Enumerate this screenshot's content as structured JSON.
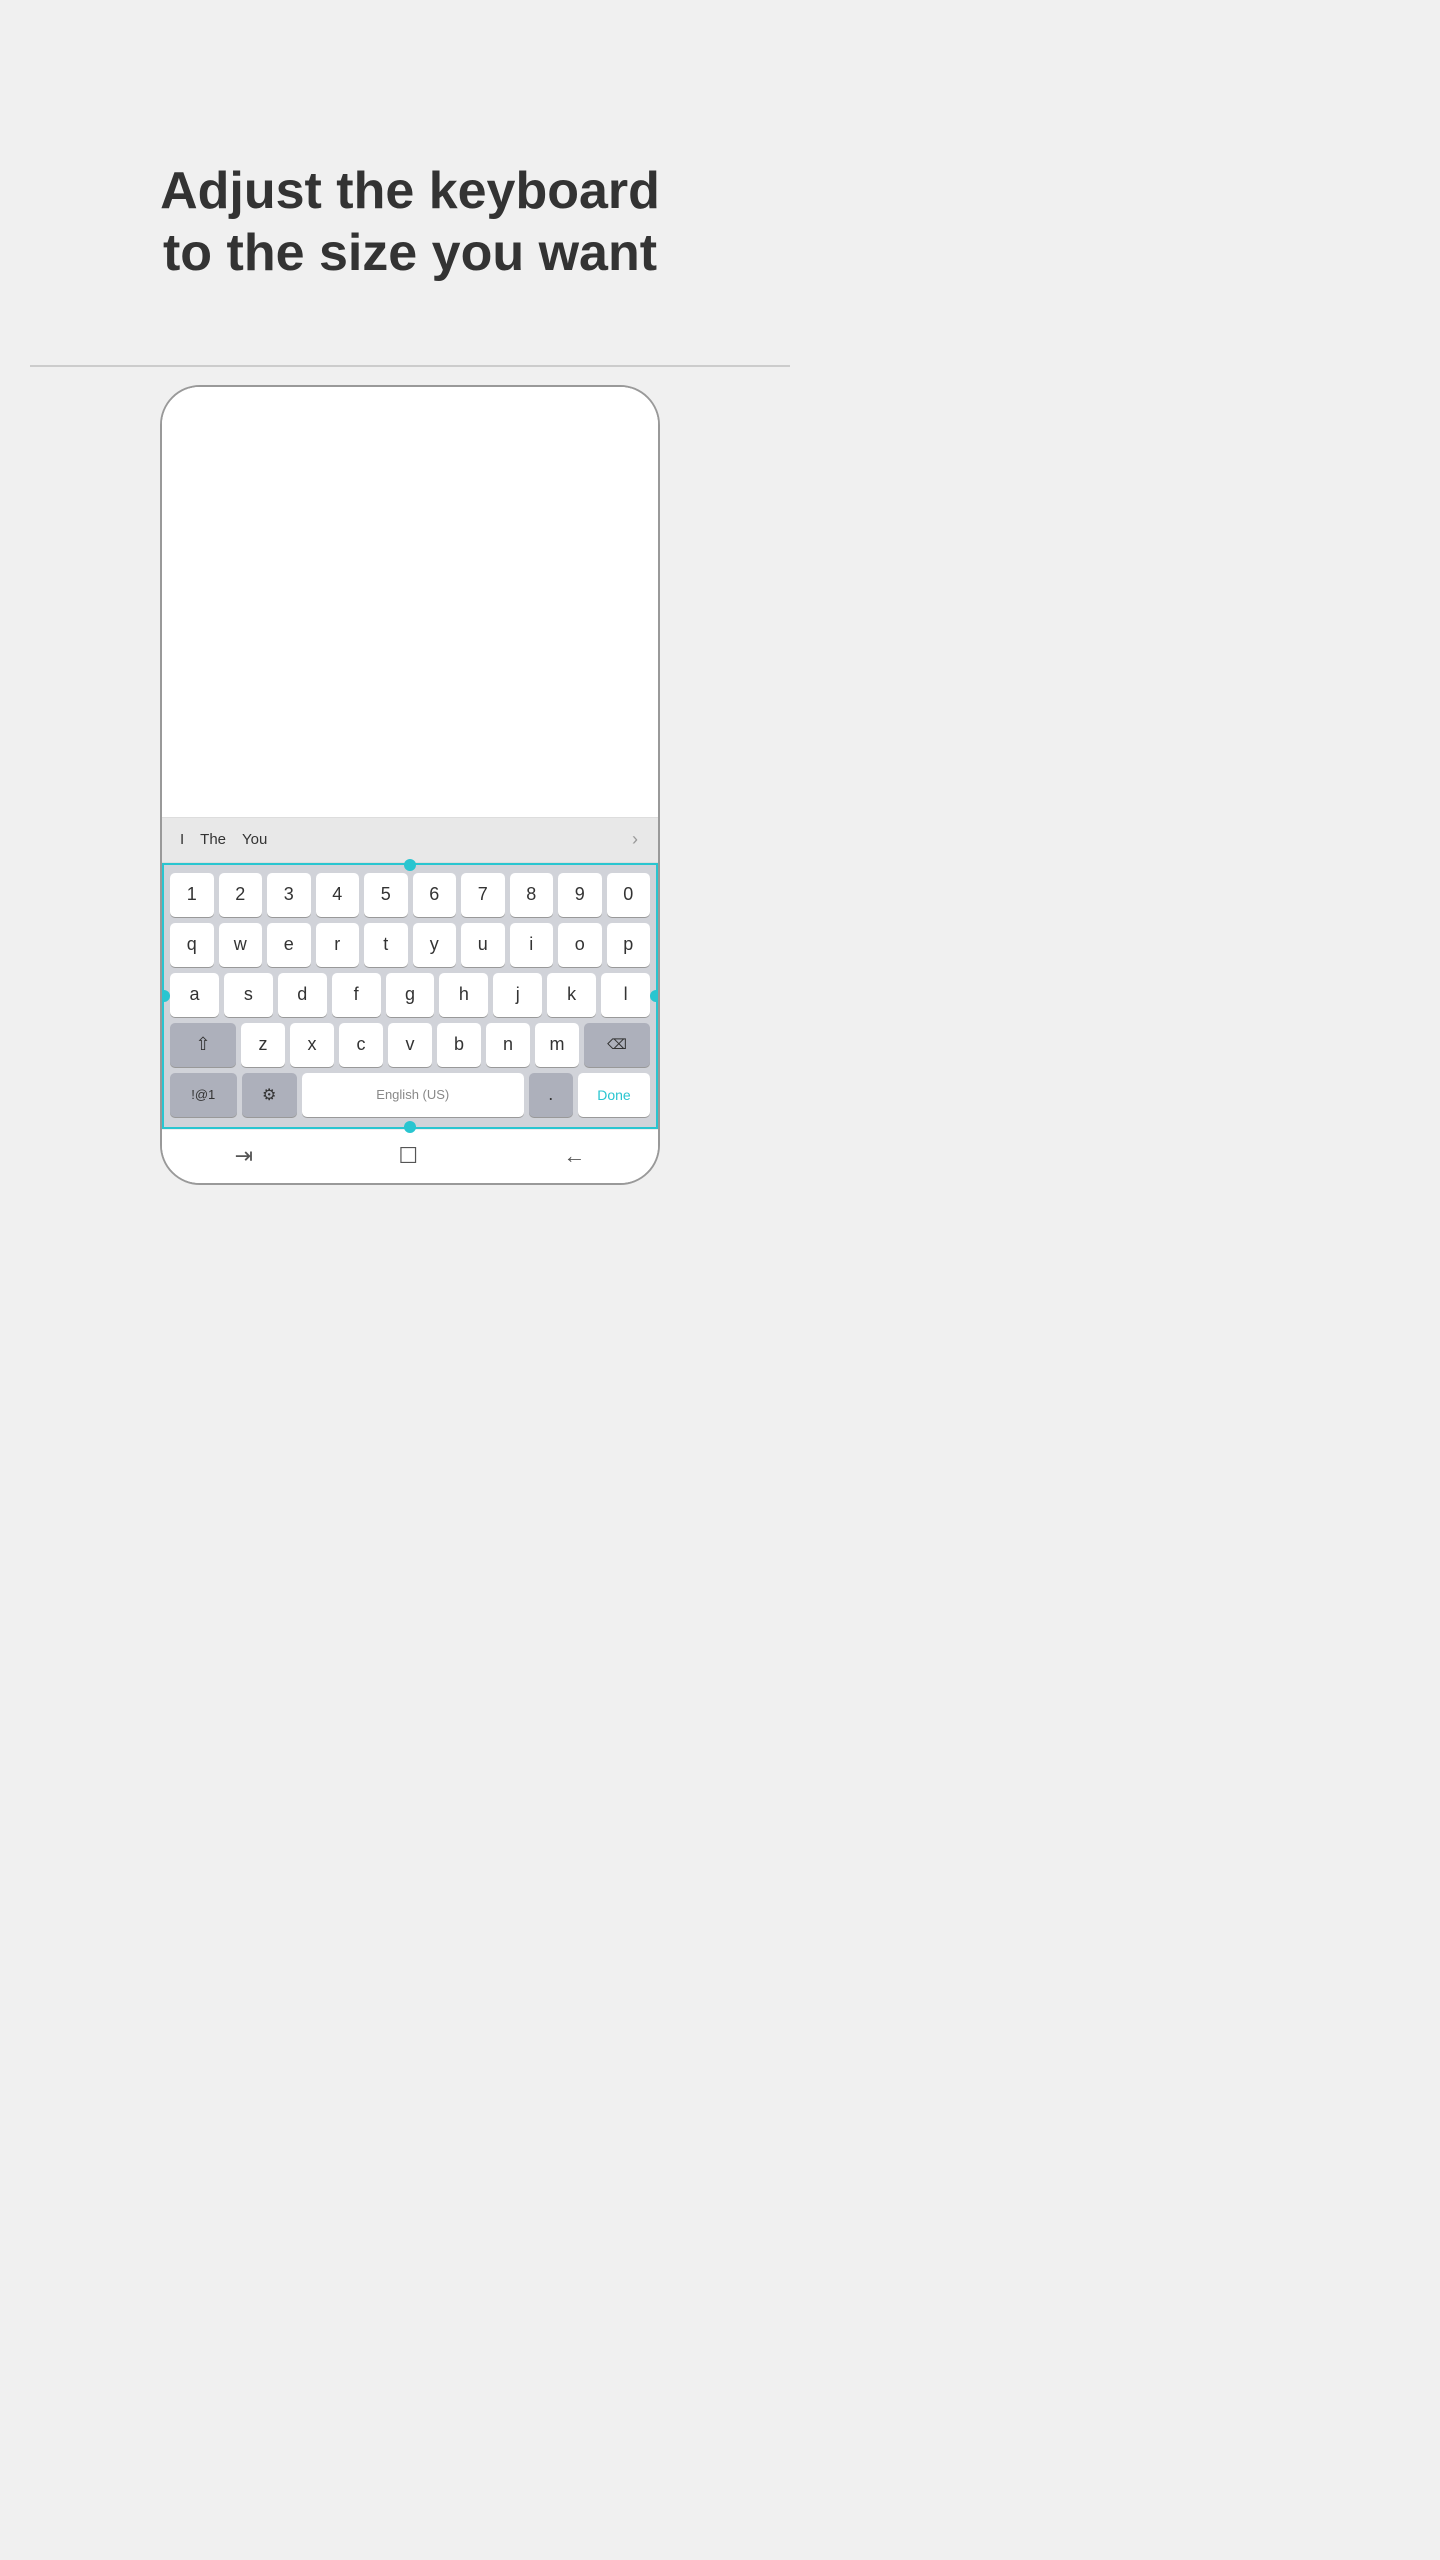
{
  "title": {
    "line1": "Adjust the keyboard",
    "line2": "to the size you want"
  },
  "suggestions": {
    "items": [
      "I",
      "The",
      "You"
    ],
    "arrow": "›"
  },
  "keyboard": {
    "row0": [
      "1",
      "2",
      "3",
      "4",
      "5",
      "6",
      "7",
      "8",
      "9",
      "0"
    ],
    "row1": [
      "q",
      "w",
      "e",
      "r",
      "t",
      "y",
      "u",
      "i",
      "o",
      "p"
    ],
    "row2": [
      "a",
      "s",
      "d",
      "f",
      "g",
      "h",
      "j",
      "k",
      "l"
    ],
    "row3_special_left": "⇧",
    "row3": [
      "z",
      "x",
      "c",
      "v",
      "b",
      "n",
      "m"
    ],
    "row3_special_right": "⌫",
    "row4_left": "!@1",
    "row4_gear": "⚙",
    "row4_space": "English (US)",
    "row4_dot": ".",
    "row4_done": "Done"
  },
  "nav": {
    "icon1": "⇥",
    "icon2": "☐",
    "icon3": "←"
  },
  "colors": {
    "accent": "#29c5d0",
    "background": "#f0f0f0"
  }
}
